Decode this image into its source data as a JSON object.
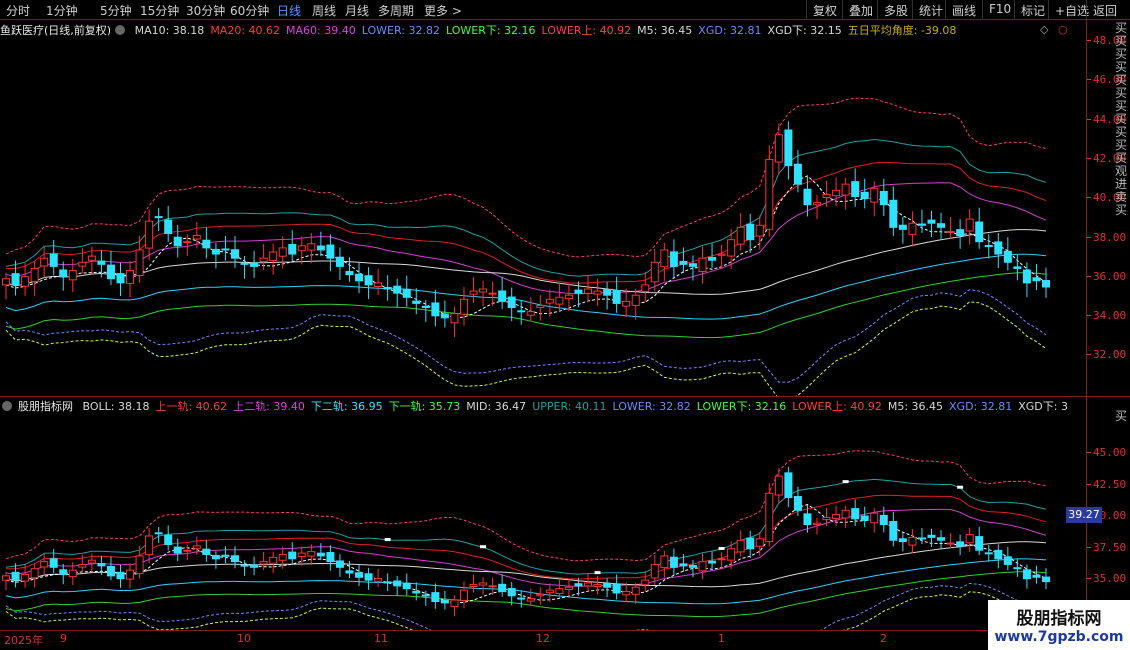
{
  "toolbar": {
    "periods": [
      "分时",
      "1分钟",
      "5分钟",
      "15分钟",
      "30分钟",
      "60分钟",
      "日线",
      "周线",
      "月线",
      "多周期",
      "更多 >"
    ],
    "active_period": "日线",
    "right_buttons": [
      "复权",
      "叠加",
      "多股",
      "统计",
      "画线",
      "F10",
      "标记",
      "+自选",
      "返回"
    ]
  },
  "main_panel": {
    "stock_title": "鱼跃医疗(日线,前复权)",
    "indicators": [
      {
        "label": "MA10: 38.18",
        "color": "#d8d8d8"
      },
      {
        "label": "MA20: 40.62",
        "color": "#ff3a3a"
      },
      {
        "label": "MA60: 39.40",
        "color": "#e040e0"
      },
      {
        "label": "LOWER: 32.82",
        "color": "#6a8cff"
      },
      {
        "label": "LOWER下: 32.16",
        "color": "#40ff40"
      },
      {
        "label": "LOWER上: 40.92",
        "color": "#ff4040"
      },
      {
        "label": "M5: 36.45",
        "color": "#d8d8d8"
      },
      {
        "label": "XGD: 32.81",
        "color": "#6a8cff"
      },
      {
        "label": "XGD下: 32.15",
        "color": "#d8d8d8"
      },
      {
        "label": "五日平均角度: -39.08",
        "color": "#c8b000"
      }
    ],
    "y_ticks": [
      "48.00",
      "46.00",
      "44.00",
      "42.00",
      "40.00",
      "38.00",
      "36.00",
      "34.00",
      "32.00"
    ]
  },
  "sub_panel": {
    "indicator_title": "股朋指标网",
    "indicators": [
      {
        "label": "BOLL: 38.18",
        "color": "#d8d8d8"
      },
      {
        "label": "上一轨: 40.62",
        "color": "#ff3a3a"
      },
      {
        "label": "上二轨: 39.40",
        "color": "#e040e0"
      },
      {
        "label": "下二轨: 36.95",
        "color": "#40e0ff"
      },
      {
        "label": "下一轨: 35.73",
        "color": "#40ff40"
      },
      {
        "label": "MID: 36.47",
        "color": "#d8d8d8"
      },
      {
        "label": "UPPER: 40.11",
        "color": "#20a0a0"
      },
      {
        "label": "LOWER: 32.82",
        "color": "#6a8cff"
      },
      {
        "label": "LOWER下: 32.16",
        "color": "#40ff40"
      },
      {
        "label": "LOWER上: 40.92",
        "color": "#ff4040"
      },
      {
        "label": "M5: 36.45",
        "color": "#d8d8d8"
      },
      {
        "label": "XGD: 32.81",
        "color": "#6a8cff"
      },
      {
        "label": "XGD下: 3",
        "color": "#d8d8d8"
      }
    ],
    "y_ticks": [
      "45.00",
      "42.50",
      "40.00",
      "37.50",
      "35.00"
    ],
    "current_price": "39.27"
  },
  "x_axis": {
    "labels": [
      "2025年",
      "9",
      "10",
      "11",
      "12",
      "1",
      "2"
    ]
  },
  "side_text_top": "买买买买买买买买买买买观进卖买",
  "side_text_bottom": "买",
  "watermark": {
    "title": "股朋指标网",
    "url": "www.7gpzb.com"
  },
  "chart_data": {
    "type": "candlestick",
    "title": "",
    "ylim": [
      31,
      49
    ],
    "close_series": [
      36.8,
      36.5,
      36.9,
      37.3,
      37.8,
      37.4,
      36.9,
      37.2,
      37.6,
      37.9,
      37.5,
      36.8,
      36.6,
      37.2,
      38.2,
      39.6,
      39.8,
      39.0,
      38.4,
      38.6,
      38.9,
      38.3,
      38.0,
      38.2,
      37.8,
      37.5,
      37.4,
      37.8,
      38.1,
      38.3,
      38.0,
      38.4,
      38.5,
      38.2,
      37.8,
      37.4,
      37.0,
      36.7,
      36.5,
      36.6,
      36.3,
      36.1,
      35.9,
      35.6,
      35.4,
      35.0,
      34.9,
      35.1,
      35.8,
      36.2,
      36.3,
      36.1,
      35.7,
      35.4,
      35.2,
      35.2,
      35.5,
      35.8,
      35.9,
      36.0,
      36.1,
      36.3,
      36.2,
      36.0,
      35.6,
      35.7,
      36.0,
      36.5,
      37.6,
      38.2,
      37.4,
      37.5,
      37.4,
      37.8,
      37.7,
      38.0,
      38.7,
      39.3,
      38.7,
      39.4,
      42.6,
      43.8,
      42.3,
      41.4,
      40.4,
      40.5,
      40.9,
      41.1,
      41.4,
      40.8,
      40.7,
      41.2,
      40.4,
      39.3,
      39.2,
      39.5,
      39.4,
      39.5,
      39.3,
      39.1,
      38.9,
      39.7,
      38.6,
      38.4,
      38.0,
      37.6,
      37.3,
      36.6,
      36.7,
      36.4
    ]
  }
}
